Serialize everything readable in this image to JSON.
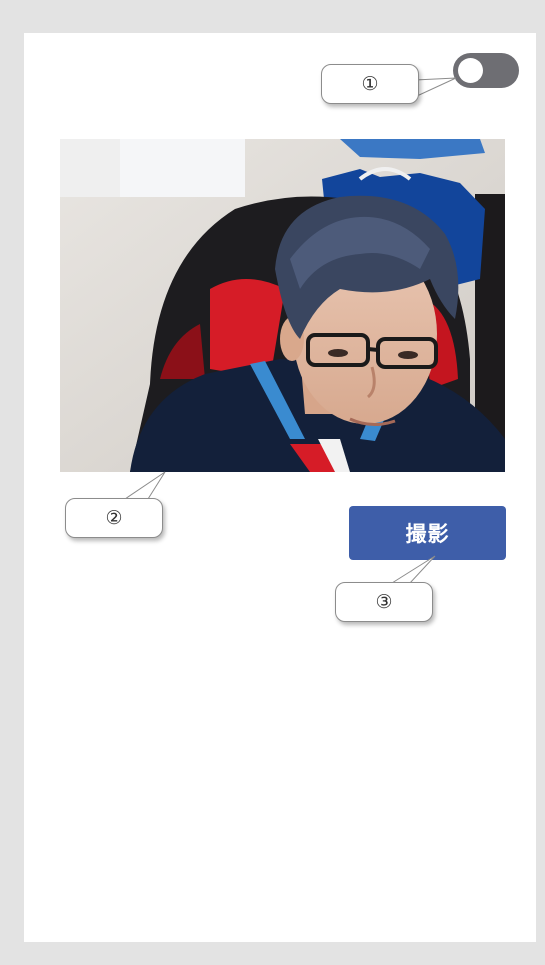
{
  "toggle": {
    "state": "off"
  },
  "capture_button": {
    "label": "撮影"
  },
  "callouts": [
    {
      "label": "①"
    },
    {
      "label": "②"
    },
    {
      "label": "③"
    }
  ],
  "colors": {
    "background": "#e3e3e3",
    "panel": "#ffffff",
    "toggle_track": "#6e6e73",
    "button": "#3e5ea9",
    "button_text": "#ffffff"
  }
}
